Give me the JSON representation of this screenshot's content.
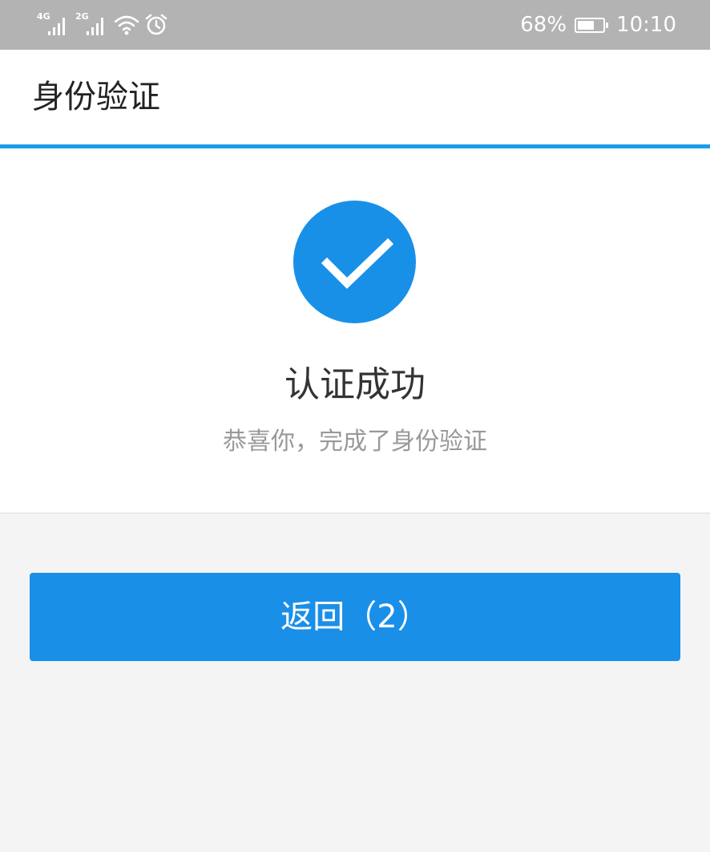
{
  "status_bar": {
    "signal_1_label": "4G",
    "signal_2_label": "2G",
    "battery_percent": "68%",
    "battery_level": 0.68,
    "time": "10:10",
    "icons": [
      "signal-4g-icon",
      "signal-2g-icon",
      "wifi-icon",
      "alarm-icon",
      "battery-icon"
    ]
  },
  "header": {
    "title": "身份验证"
  },
  "result": {
    "icon": "check-icon",
    "title": "认证成功",
    "subtitle": "恭喜你，完成了身份验证"
  },
  "actions": {
    "back_label": "返回（2）"
  },
  "colors": {
    "accent": "#1a8fe8",
    "status_bar": "#b3b3b3",
    "background": "#f4f4f4"
  }
}
